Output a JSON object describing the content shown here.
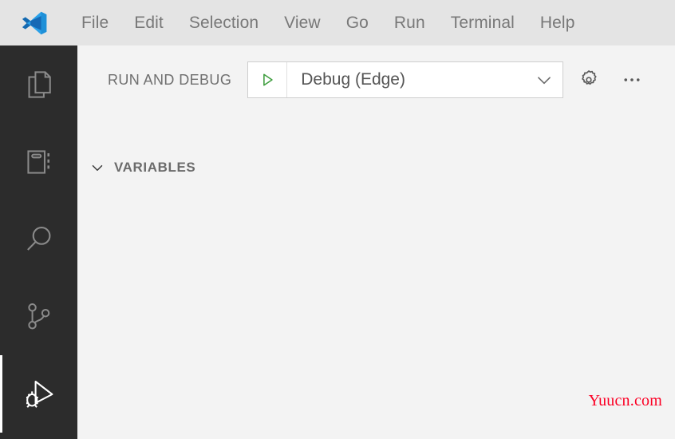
{
  "window": {
    "app_name": "Visual Studio Code",
    "logo_icon": "vscode-logo",
    "menubar_bg": "#e4e4e4",
    "panel_bg": "#f3f3f3",
    "activitybar_bg": "#2c2c2c"
  },
  "menubar": {
    "items": [
      {
        "label": "File"
      },
      {
        "label": "Edit"
      },
      {
        "label": "Selection"
      },
      {
        "label": "View"
      },
      {
        "label": "Go"
      },
      {
        "label": "Run"
      },
      {
        "label": "Terminal"
      },
      {
        "label": "Help"
      }
    ]
  },
  "activitybar": {
    "active_index": 4,
    "active_indicator_color": "#ffffff",
    "items": [
      {
        "name": "explorer",
        "icon": "files-icon",
        "title": "Explorer"
      },
      {
        "name": "open-editors",
        "icon": "notebook-icon",
        "title": "Open Editors"
      },
      {
        "name": "search",
        "icon": "search-icon",
        "title": "Search"
      },
      {
        "name": "source-control",
        "icon": "source-control-icon",
        "title": "Source Control"
      },
      {
        "name": "run-and-debug",
        "icon": "run-and-debug-icon",
        "title": "Run and Debug"
      }
    ]
  },
  "debug": {
    "title": "RUN AND DEBUG",
    "config": {
      "selected": "Debug (Edge)",
      "start_icon": "play-triangle-icon",
      "start_color": "#3f9e3f",
      "chevron_icon": "chevron-down-icon"
    },
    "actions": [
      {
        "name": "open-launch-json",
        "icon": "gear-icon",
        "label": ""
      },
      {
        "name": "more-actions",
        "icon": "ellipsis-icon",
        "label": ""
      }
    ],
    "sections": [
      {
        "name": "variables",
        "label": "VARIABLES",
        "expanded": true,
        "chevron_icon": "chevron-down-icon"
      }
    ]
  },
  "watermark": {
    "text": "Yuucn.com",
    "color": "#fb0226"
  }
}
